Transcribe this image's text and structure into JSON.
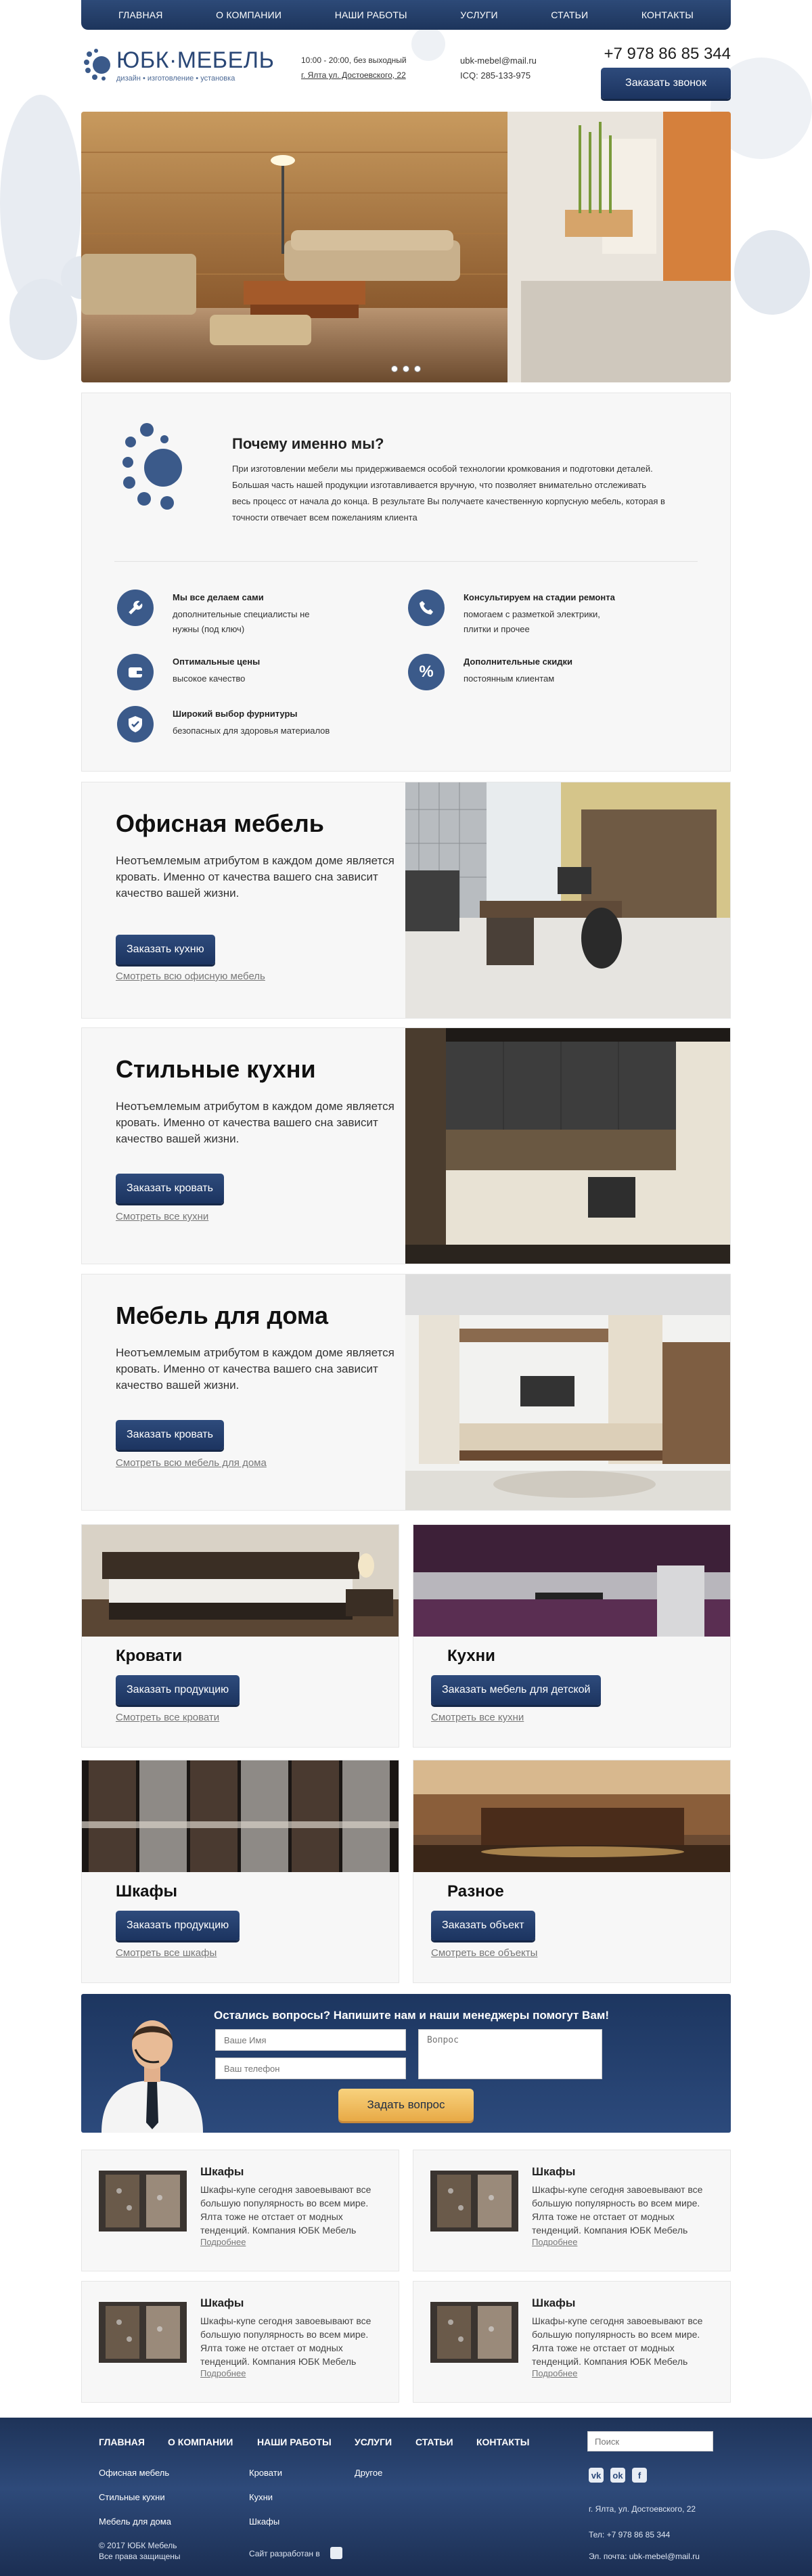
{
  "nav": {
    "items": [
      "ГЛАВНАЯ",
      "О КОМПАНИИ",
      "НАШИ РАБОТЫ",
      "УСЛУГИ",
      "СТАТЬИ",
      "КОНТАКТЫ"
    ]
  },
  "header": {
    "logo_title": "ЮБК·МЕБЕЛЬ",
    "logo_sub": "дизайн • изготовление • установка",
    "hours": "10:00 - 20:00, без выходный",
    "address": "г. Ялта ул. Достоевского, 22",
    "email": "ubk-mebel@mail.ru",
    "icq": "ICQ: 285-133-975",
    "phone": "+7 978 86 85 344",
    "call_button": "Заказать звонок"
  },
  "why": {
    "title": "Почему именно мы?",
    "text": "При изготовлении мебели мы придерживаемся особой технологии кромкования и подготовки деталей. Большая часть нашей продукции изготавливается вручную, что позволяет внимательно отслеживать весь процесс от начала до конца. В результате Вы получаете качественную корпусную мебель, которая в точности отвечает всем пожеланиям клиента",
    "features": [
      {
        "icon": "wrench-icon",
        "title": "Мы все делаем сами",
        "desc": "дополнительные специалисты не нужны (под ключ)"
      },
      {
        "icon": "phone-icon",
        "title": "Консультируем на стадии ремонта",
        "desc": "помогаем с разметкой электрики, плитки и прочее"
      },
      {
        "icon": "wallet-icon",
        "title": "Оптимальные цены",
        "desc": "высокое качество"
      },
      {
        "icon": "percent-icon",
        "title": "Дополнительные скидки",
        "desc": "постоянным клиентам"
      },
      {
        "icon": "shield-check-icon",
        "title": "Широкий выбор фурнитуры",
        "desc": "безопасных для здоровья материалов"
      }
    ]
  },
  "categories": [
    {
      "title": "Офисная мебель",
      "text": "Неотъемлемым атрибутом в каждом доме является кровать. Именно от качества вашего сна зависит качество вашей жизни.",
      "button": "Заказать кухню",
      "link": "Смотреть всю офисную мебель"
    },
    {
      "title": "Стильные кухни",
      "text": "Неотъемлемым атрибутом в каждом доме является кровать. Именно от качества вашего сна зависит качество вашей жизни.",
      "button": "Заказать кровать",
      "link": "Смотреть все кухни"
    },
    {
      "title": "Мебель для дома",
      "text": "Неотъемлемым атрибутом в каждом доме является кровать. Именно от качества вашего сна зависит качество вашей жизни.",
      "button": "Заказать кровать",
      "link": "Смотреть всю мебель для дома"
    }
  ],
  "cards": [
    {
      "title": "Кровати",
      "button": "Заказать продукцию",
      "link": "Смотреть все кровати"
    },
    {
      "title": "Кухни",
      "button": "Заказать мебель для детской",
      "link": "Смотреть все кухни"
    },
    {
      "title": "Шкафы",
      "button": "Заказать продукцию",
      "link": "Смотреть все шкафы"
    },
    {
      "title": "Разное",
      "button": "Заказать объект",
      "link": "Смотреть все объекты"
    }
  ],
  "contact": {
    "title": "Остались вопросы? Напишите нам и наши менеджеры помогут Вам!",
    "name_placeholder": "Ваше Имя",
    "phone_placeholder": "Ваш телефон",
    "question_placeholder": "Вопрос",
    "button": "Задать вопрос"
  },
  "news": [
    {
      "title": "Шкафы",
      "desc": "Шкафы-купе сегодня завоевывают все большую популярность во всем мире. Ялта тоже не отстает от модных тенденций. Компания ЮБК Мебель",
      "link": "Подробнее"
    },
    {
      "title": "Шкафы",
      "desc": "Шкафы-купе сегодня завоевывают все большую популярность во всем мире. Ялта тоже не отстает от модных тенденций. Компания ЮБК Мебель",
      "link": "Подробнее"
    },
    {
      "title": "Шкафы",
      "desc": "Шкафы-купе сегодня завоевывают все большую популярность во всем мире. Ялта тоже не отстает от модных тенденций. Компания ЮБК Мебель",
      "link": "Подробнее"
    },
    {
      "title": "Шкафы",
      "desc": "Шкафы-купе сегодня завоевывают все большую популярность во всем мире. Ялта тоже не отстает от модных тенденций. Компания ЮБК Мебель",
      "link": "Подробнее"
    }
  ],
  "footer": {
    "nav": [
      "ГЛАВНАЯ",
      "О КОМПАНИИ",
      "НАШИ РАБОТЫ",
      "УСЛУГИ",
      "СТАТЬИ",
      "КОНТАКТЫ"
    ],
    "col1": [
      "Офисная мебель",
      "Стильные кухни",
      "Мебель для дома"
    ],
    "col2": [
      "Кровати",
      "Кухни",
      "Шкафы"
    ],
    "col3": [
      "Другое"
    ],
    "search_placeholder": "Поиск",
    "social": [
      "vk",
      "ok",
      "f"
    ],
    "copyright": "© 2017 ЮБК Мебель",
    "rights": "Все права защищены",
    "developer": "Сайт разработан в",
    "address": "г. Ялта, ул. Достоевского, 22",
    "phone": "Тел: +7 978 86 85 344",
    "email": "Эл. почта: ubk-mebel@mail.ru"
  },
  "colors": {
    "brand": "#2a4776",
    "accent": "#e8aa46"
  }
}
